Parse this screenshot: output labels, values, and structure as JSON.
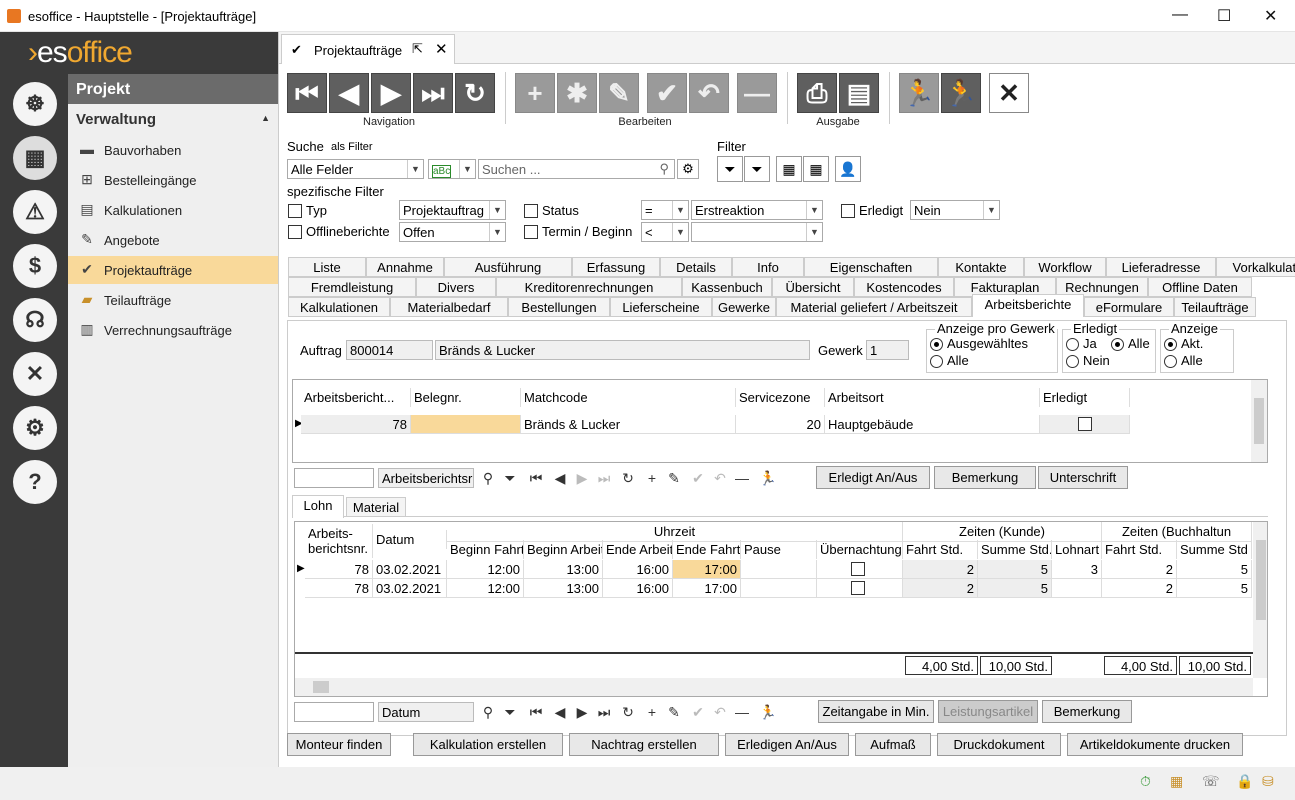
{
  "window": {
    "title": "esoffice - Hauptstelle - [Projektaufträge]",
    "min": "—",
    "max": "☐",
    "close": "✕"
  },
  "brand": {
    "es": "es",
    "office": "office"
  },
  "sidebar": {
    "header": "Projekt",
    "section": "Verwaltung",
    "items": [
      {
        "label": "Bauvorhaben",
        "icon": "construction-icon"
      },
      {
        "label": "Bestelleingänge",
        "icon": "basket-icon"
      },
      {
        "label": "Kalkulationen",
        "icon": "calculator-icon"
      },
      {
        "label": "Angebote",
        "icon": "offer-icon"
      },
      {
        "label": "Projektaufträge",
        "icon": "check-circle-icon"
      },
      {
        "label": "Teilaufträge",
        "icon": "partial-order-icon"
      },
      {
        "label": "Verrechnungsaufträge",
        "icon": "settlement-icon"
      }
    ]
  },
  "doc_tab": {
    "label": "Projektaufträge"
  },
  "toolbar": {
    "navigation": "Navigation",
    "bearbeiten": "Bearbeiten",
    "ausgabe": "Ausgabe"
  },
  "search": {
    "label": "Suche",
    "as_filter": "als Filter",
    "field": "Alle Felder",
    "placeholder": "Suchen ...",
    "filter_label": "Filter"
  },
  "spec": {
    "title": "spezifische Filter",
    "typ": "Typ",
    "typ_val": "Projektauftrag",
    "offline": "Offlineberichte",
    "offline_val": "Offen",
    "status": "Status",
    "status_op": "=",
    "status_val": "Erstreaktion",
    "termin": "Termin / Beginn",
    "termin_op": "<",
    "erledigt": "Erledigt",
    "erledigt_val": "Nein"
  },
  "tabs": {
    "row1": [
      "Liste",
      "Annahme",
      "Ausführung",
      "Erfassung",
      "Details",
      "Info",
      "Eigenschaften",
      "Kontakte",
      "Workflow",
      "Lieferadresse",
      "Vorkalkulation"
    ],
    "row2": [
      "Fremdleistung",
      "Divers",
      "Kreditorenrechnungen",
      "Kassenbuch",
      "Übersicht",
      "Kostencodes",
      "Fakturaplan",
      "Rechnungen",
      "Offline Daten"
    ],
    "row3": [
      "Kalkulationen",
      "Materialbedarf",
      "Bestellungen",
      "Lieferscheine",
      "Gewerke",
      "Material geliefert / Arbeitszeit",
      "Arbeitsberichte",
      "eFormulare",
      "Teilaufträge"
    ]
  },
  "auftrag": {
    "label": "Auftrag",
    "nr": "800014",
    "name": "Bränds & Lucker",
    "gewerk_label": "Gewerk",
    "gewerk": "1"
  },
  "anzeige_gewerk": {
    "title": "Anzeige pro Gewerk",
    "a": "Ausgewähltes",
    "b": "Alle"
  },
  "erledigt_grp": {
    "title": "Erledigt",
    "ja": "Ja",
    "alle": "Alle",
    "nein": "Nein"
  },
  "anzeige_grp": {
    "title": "Anzeige",
    "akt": "Akt.",
    "alle": "Alle"
  },
  "grid1": {
    "headers": [
      "Arbeitsbericht...",
      "Belegnr.",
      "Matchcode",
      "Servicezone",
      "Arbeitsort",
      "Erledigt"
    ],
    "row": {
      "nr": "78",
      "beleg": "",
      "match": "Bränds & Lucker",
      "zone": "20",
      "ort": "Hauptgebäude"
    }
  },
  "nav1": {
    "combo": "Arbeitsberichtsr",
    "b1": "Erledigt An/Aus",
    "b2": "Bemerkung",
    "b3": "Unterschrift"
  },
  "subtabs": [
    "Lohn",
    "Material"
  ],
  "grid2": {
    "h_nr": "Arbeits-\nberichtsnr.",
    "h_datum": "Datum",
    "h_uhrzeit": "Uhrzeit",
    "h_kunde": "Zeiten (Kunde)",
    "h_buch": "Zeiten (Buchhaltun",
    "cols": [
      "Beginn Fahrt",
      "Beginn Arbeit",
      "Ende Arbeit",
      "Ende Fahrt",
      "Pause",
      "Übernachtung",
      "Fahrt Std.",
      "Summe Std.",
      "Lohnart",
      "Fahrt Std.",
      "Summe Std"
    ],
    "rows": [
      {
        "nr": "78",
        "datum": "03.02.2021",
        "bf": "12:00",
        "ba": "13:00",
        "ea": "16:00",
        "ef": "17:00",
        "fahrt": "2",
        "summe": "5",
        "lohnart": "3",
        "bfahrt": "2",
        "bsumme": "5"
      },
      {
        "nr": "78",
        "datum": "03.02.2021",
        "bf": "12:00",
        "ba": "13:00",
        "ea": "16:00",
        "ef": "17:00",
        "fahrt": "2",
        "summe": "5",
        "lohnart": "",
        "bfahrt": "2",
        "bsumme": "5"
      }
    ],
    "totals": [
      "4,00 Std.",
      "10,00 Std.",
      "4,00 Std.",
      "10,00 Std."
    ]
  },
  "nav2": {
    "combo": "Datum",
    "b1": "Zeitangabe in Min.",
    "b2": "Leistungsartikel",
    "b3": "Bemerkung"
  },
  "bottom_buttons": [
    "Monteur finden",
    "Kalkulation erstellen",
    "Nachtrag erstellen",
    "Erledigen An/Aus",
    "Aufmaß",
    "Druckdokument",
    "Artikeldokumente drucken"
  ]
}
